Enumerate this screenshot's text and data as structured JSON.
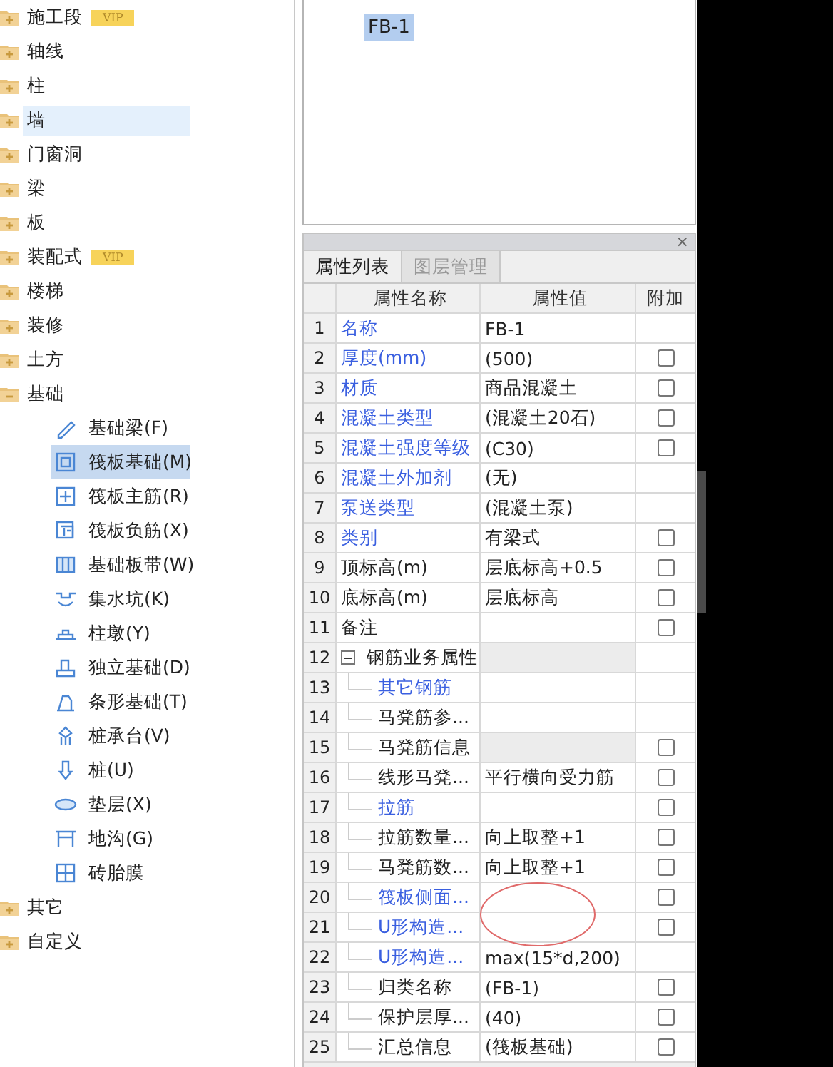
{
  "tree": [
    {
      "label": "施工段",
      "vip": "VIP",
      "expanded": false,
      "highlighted": false
    },
    {
      "label": "轴线",
      "expanded": false,
      "highlighted": false
    },
    {
      "label": "柱",
      "expanded": false,
      "highlighted": false
    },
    {
      "label": "墙",
      "expanded": false,
      "highlighted": true
    },
    {
      "label": "门窗洞",
      "expanded": false,
      "highlighted": false
    },
    {
      "label": "梁",
      "expanded": false,
      "highlighted": false
    },
    {
      "label": "板",
      "expanded": false,
      "highlighted": false
    },
    {
      "label": "装配式",
      "vip": "VIP",
      "expanded": false,
      "highlighted": false
    },
    {
      "label": "楼梯",
      "expanded": false,
      "highlighted": false
    },
    {
      "label": "装修",
      "expanded": false,
      "highlighted": false
    },
    {
      "label": "土方",
      "expanded": false,
      "highlighted": false
    },
    {
      "label": "基础",
      "expanded": true,
      "highlighted": false,
      "children": [
        {
          "label": "基础梁(F)",
          "selected": false
        },
        {
          "label": "筏板基础(M)",
          "selected": true
        },
        {
          "label": "筏板主筋(R)",
          "selected": false
        },
        {
          "label": "筏板负筋(X)",
          "selected": false
        },
        {
          "label": "基础板带(W)",
          "selected": false
        },
        {
          "label": "集水坑(K)",
          "selected": false
        },
        {
          "label": "柱墩(Y)",
          "selected": false
        },
        {
          "label": "独立基础(D)",
          "selected": false
        },
        {
          "label": "条形基础(T)",
          "selected": false
        },
        {
          "label": "桩承台(V)",
          "selected": false
        },
        {
          "label": "桩(U)",
          "selected": false
        },
        {
          "label": "垫层(X)",
          "selected": false
        },
        {
          "label": "地沟(G)",
          "selected": false
        },
        {
          "label": "砖胎膜",
          "selected": false
        }
      ]
    },
    {
      "label": "其它",
      "expanded": false,
      "highlighted": false
    },
    {
      "label": "自定义",
      "expanded": false,
      "highlighted": false
    }
  ],
  "component_list": {
    "items": [
      {
        "label": "FB-1",
        "selected": true
      }
    ]
  },
  "properties_panel": {
    "close": "×",
    "tabs": [
      {
        "label": "属性列表",
        "selected": true
      },
      {
        "label": "图层管理",
        "selected": false
      }
    ],
    "columns": [
      "属性名称",
      "属性值",
      "附加"
    ],
    "rows": [
      {
        "num": "1",
        "name": "名称",
        "value": "FB-1",
        "link": true
      },
      {
        "num": "2",
        "name": "厚度(mm)",
        "value": "(500)",
        "link": true,
        "checked": false
      },
      {
        "num": "3",
        "name": "材质",
        "value": "商品混凝土",
        "link": true,
        "checked": false
      },
      {
        "num": "4",
        "name": "混凝土类型",
        "value": "(混凝土20石)",
        "link": true,
        "checked": false
      },
      {
        "num": "5",
        "name": "混凝土强度等级",
        "value": "(C30)",
        "link": true,
        "checked": false
      },
      {
        "num": "6",
        "name": "混凝土外加剂",
        "value": "(无)",
        "link": true
      },
      {
        "num": "7",
        "name": "泵送类型",
        "value": "(混凝土泵)",
        "link": true
      },
      {
        "num": "8",
        "name": "类别",
        "value": "有梁式",
        "link": true,
        "checked": false
      },
      {
        "num": "9",
        "name": "顶标高(m)",
        "value": "层底标高+0.5",
        "link": false,
        "checked": false
      },
      {
        "num": "10",
        "name": "底标高(m)",
        "value": "层底标高",
        "link": false,
        "checked": false
      },
      {
        "num": "11",
        "name": "备注",
        "link": false,
        "checked": false
      },
      {
        "num": "12",
        "name": "钢筋业务属性",
        "link": false,
        "readonly": true,
        "expanded": true,
        "children": [
          {
            "num": "13",
            "name": "其它钢筋",
            "link": true
          },
          {
            "num": "14",
            "name": "马凳筋参...",
            "link": false
          },
          {
            "num": "15",
            "name": "马凳筋信息",
            "link": false,
            "readonly": true,
            "checked": false
          },
          {
            "num": "16",
            "name": "线形马凳...",
            "value": "平行横向受力筋",
            "link": false,
            "checked": false
          },
          {
            "num": "17",
            "name": "拉筋",
            "link": true,
            "checked": false
          },
          {
            "num": "18",
            "name": "拉筋数量...",
            "value": "向上取整+1",
            "link": false,
            "checked": false
          },
          {
            "num": "19",
            "name": "马凳筋数...",
            "value": "向上取整+1",
            "link": false,
            "checked": false
          },
          {
            "num": "20",
            "name": "筏板侧面...",
            "link": true,
            "checked": false
          },
          {
            "num": "21",
            "name": "U形构造...",
            "link": true,
            "checked": false
          },
          {
            "num": "22",
            "name": "U形构造...",
            "value": "max(15*d,200)",
            "link": true
          },
          {
            "num": "23",
            "name": "归类名称",
            "value": "(FB-1)",
            "link": false,
            "checked": false
          },
          {
            "num": "24",
            "name": "保护层厚...",
            "value": "(40)",
            "link": false,
            "checked": false
          },
          {
            "num": "25",
            "name": "汇总信息",
            "value": "(筏板基础)",
            "link": false,
            "checked": false
          }
        ]
      }
    ]
  },
  "annotation": {
    "kind": "ellipse",
    "color": "#e06a6a"
  }
}
